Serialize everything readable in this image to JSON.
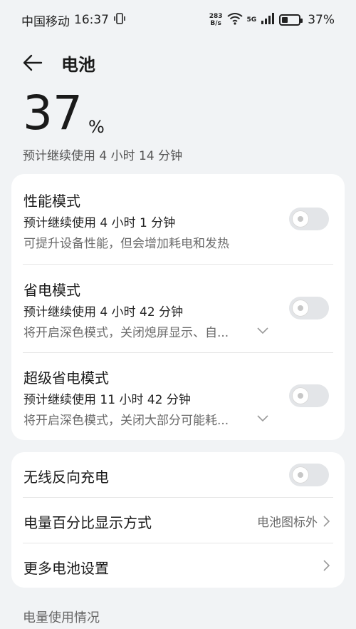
{
  "status_bar": {
    "carrier": "中国移动",
    "time": "16:37",
    "net_speed_value": "283",
    "net_speed_unit": "B/s",
    "network": "5G",
    "battery_percent": "37%",
    "battery_level": 0.37
  },
  "header": {
    "title": "电池"
  },
  "battery": {
    "percent_value": "37",
    "percent_sign": "%",
    "estimate": "预计继续使用 4 小时 14 分钟"
  },
  "modes": [
    {
      "title": "性能模式",
      "estimate": "预计继续使用 4 小时 1 分钟",
      "desc": "可提升设备性能，但会增加耗电和发热",
      "enabled": false
    },
    {
      "title": "省电模式",
      "estimate": "预计继续使用 4 小时 42 分钟",
      "desc": "将开启深色模式，关闭熄屏显示、自...",
      "enabled": false
    },
    {
      "title": "超级省电模式",
      "estimate": "预计继续使用 11 小时 42 分钟",
      "desc": "将开启深色模式，关闭大部分可能耗...",
      "enabled": false
    }
  ],
  "settings": {
    "reverse_charging": {
      "label": "无线反向充电",
      "enabled": false
    },
    "percentage_display": {
      "label": "电量百分比显示方式",
      "value": "电池图标外"
    },
    "more_settings": {
      "label": "更多电池设置"
    }
  },
  "section": {
    "usage_label": "电量使用情况"
  }
}
